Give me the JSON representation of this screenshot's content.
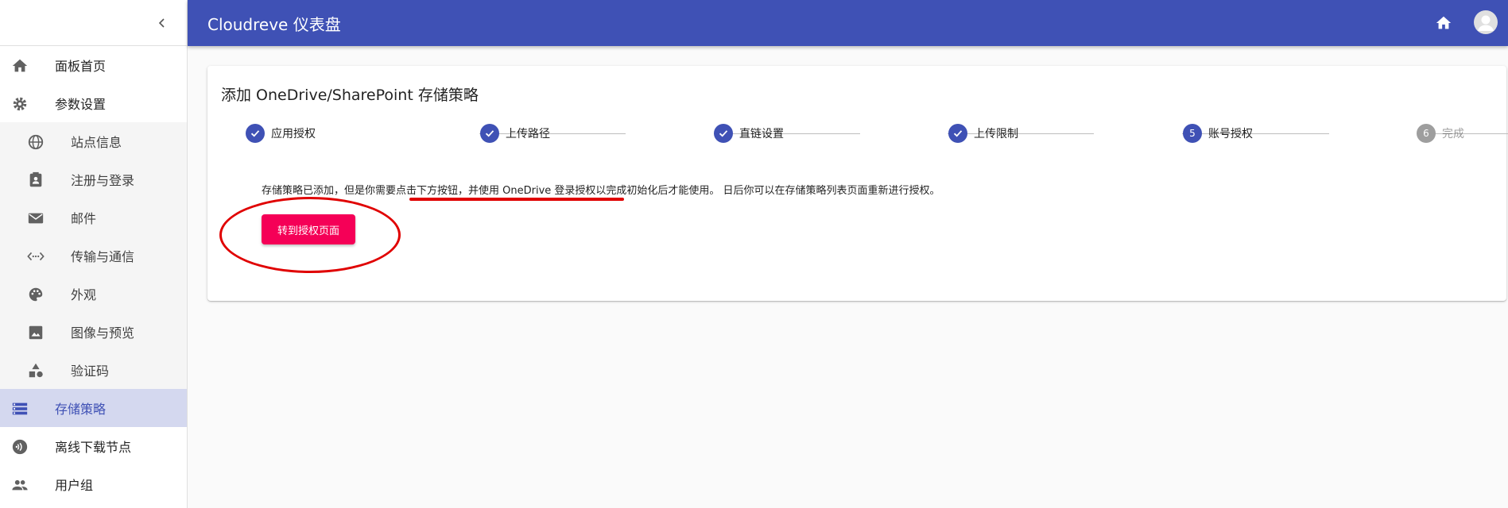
{
  "app": {
    "title": "Cloudreve 仪表盘"
  },
  "sidebar": {
    "items": [
      {
        "label": "面板首页",
        "icon": "home-icon"
      },
      {
        "label": "参数设置",
        "icon": "gear-icon"
      },
      {
        "label": "站点信息",
        "icon": "globe-icon"
      },
      {
        "label": "注册与登录",
        "icon": "contact-card-icon"
      },
      {
        "label": "邮件",
        "icon": "mail-icon"
      },
      {
        "label": "传输与通信",
        "icon": "code-dots-icon"
      },
      {
        "label": "外观",
        "icon": "palette-icon"
      },
      {
        "label": "图像与预览",
        "icon": "image-icon"
      },
      {
        "label": "验证码",
        "icon": "shapes-icon"
      },
      {
        "label": "存储策略",
        "icon": "storage-list-icon"
      },
      {
        "label": "离线下载节点",
        "icon": "download-node-icon"
      },
      {
        "label": "用户组",
        "icon": "people-icon"
      }
    ]
  },
  "card": {
    "title": "添加 OneDrive/SharePoint 存储策略",
    "steps": [
      {
        "label": "应用授权",
        "number": "1",
        "state": "done"
      },
      {
        "label": "上传路径",
        "number": "2",
        "state": "done"
      },
      {
        "label": "直链设置",
        "number": "3",
        "state": "done"
      },
      {
        "label": "上传限制",
        "number": "4",
        "state": "done"
      },
      {
        "label": "账号授权",
        "number": "5",
        "state": "current"
      },
      {
        "label": "完成",
        "number": "6",
        "state": "pending"
      }
    ],
    "description": "存储策略已添加，但是你需要点击下方按钮，并使用 OneDrive 登录授权以完成初始化后才能使用。 日后你可以在存储策略列表页面重新进行授权。",
    "button_label": "转到授权页面"
  },
  "colors": {
    "primary": "#3f51b5",
    "accent": "#f50057",
    "annotation": "#e00000",
    "active_nav_bg": "#d4d8ef"
  }
}
